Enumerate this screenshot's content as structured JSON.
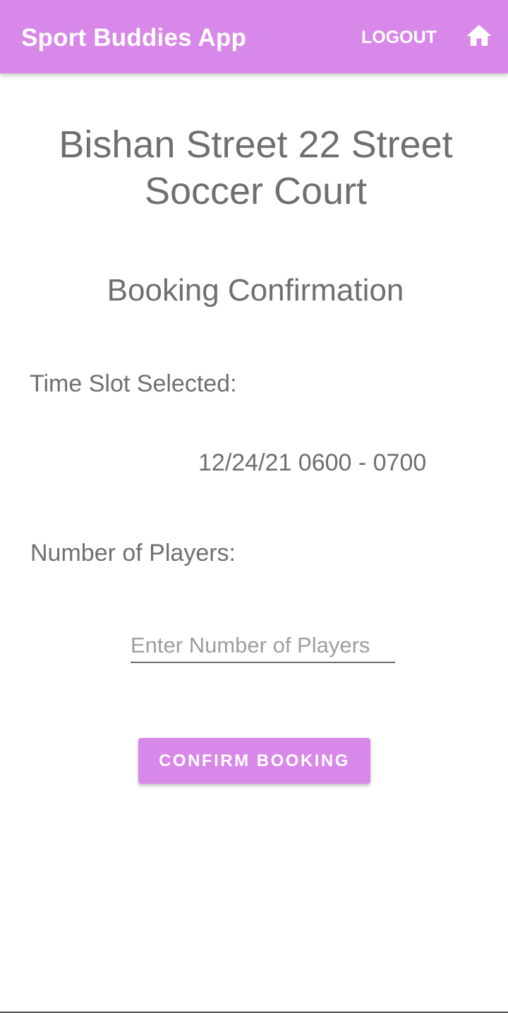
{
  "app_bar": {
    "title": "Sport Buddies App",
    "logout_label": "LOGOUT",
    "home_icon": "home-icon",
    "background_color": "#d888e8",
    "text_color": "#ffffff"
  },
  "page": {
    "venue_title": "Bishan Street 22 Street Soccer Court",
    "section_title": "Booking Confirmation",
    "time_slot_label": "Time Slot Selected:",
    "time_slot_value": "12/24/21 0600 - 0700",
    "players_label": "Number of Players:",
    "players_input": {
      "value": "",
      "placeholder": "Enter Number of Players"
    },
    "confirm_button_label": "CONFIRM BOOKING",
    "text_color": "#6f6f6f",
    "accent_color": "#d888e8"
  }
}
